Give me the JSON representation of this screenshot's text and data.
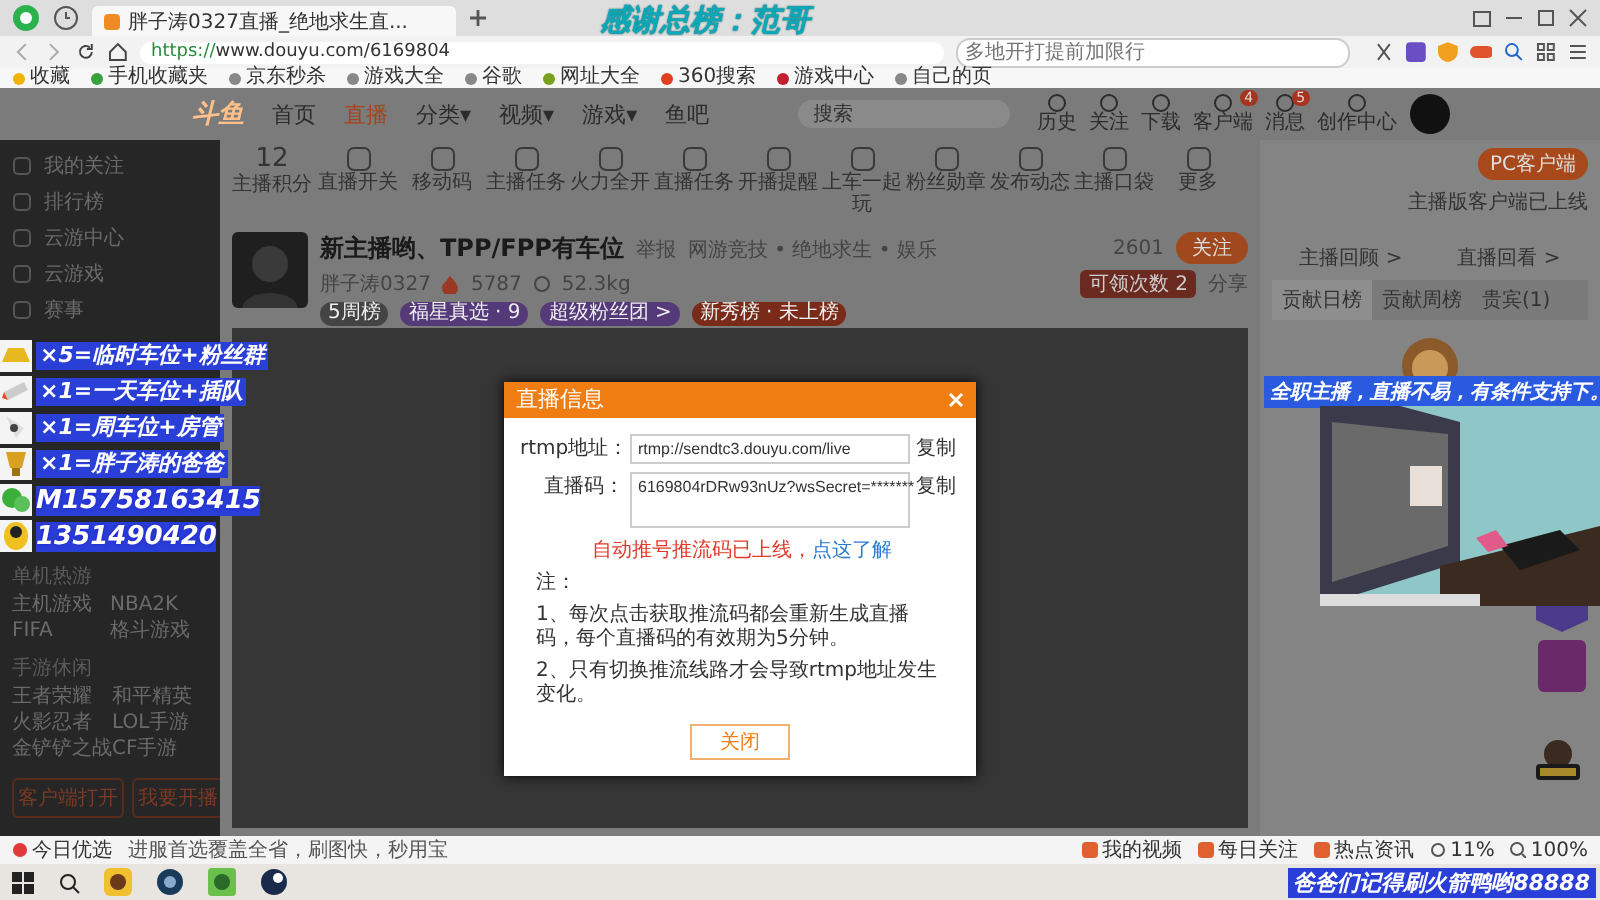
{
  "browser": {
    "tab_title": "胖子涛0327直播_绝地求生直...",
    "url": "https://www.douyu.com/6169804",
    "search": {
      "placeholder": "多地开打提前加限行"
    },
    "bookmarks": [
      "收藏",
      "手机收藏夹",
      "京东秒杀",
      "游戏大全",
      "谷歌",
      "网址大全",
      "360搜索",
      "游戏中心",
      "自己的页"
    ]
  },
  "site_nav": {
    "logo": "斗鱼",
    "items": [
      {
        "label": "首页",
        "selected": false
      },
      {
        "label": "直播",
        "selected": true
      },
      {
        "label": "分类▾",
        "selected": false
      },
      {
        "label": "视频▾",
        "selected": false
      },
      {
        "label": "游戏▾",
        "selected": false
      },
      {
        "label": "鱼吧",
        "selected": false
      }
    ],
    "search": {
      "placeholder": "搜索"
    },
    "actions": [
      {
        "label": "历史"
      },
      {
        "label": "关注"
      },
      {
        "label": "下载"
      },
      {
        "label": "客户端",
        "badge": "4"
      },
      {
        "label": "消息",
        "badge": "5"
      },
      {
        "label": "创作中心"
      }
    ]
  },
  "sidebar": {
    "items": [
      "我的关注",
      "排行榜",
      "云游中心",
      "云游戏",
      "赛事"
    ],
    "sections": [
      {
        "title": "单机热游",
        "games": [
          "主机游戏",
          "NBA2K",
          "FIFA",
          "格斗游戏"
        ]
      },
      {
        "title": "手游休闲",
        "games": [
          "王者荣耀",
          "和平精英",
          "火影忍者",
          "LOL手游",
          "金铲铲之战",
          "CF手游"
        ]
      }
    ],
    "buttons": [
      "客户端打开",
      "我要开播"
    ]
  },
  "toolbar": {
    "score": "12",
    "score_label": "主播积分",
    "tools": [
      "直播开关",
      "移动码",
      "主播任务",
      "火力全开",
      "直播任务",
      "开播提醒",
      "上车一起玩",
      "粉丝勋章",
      "发布动态",
      "主播口袋",
      "更多"
    ]
  },
  "streamer": {
    "title": "新主播哟、TPP/FPP有车位",
    "report": "举报",
    "category": "网游竞技 • 绝地求生 • 娱乐",
    "name": "胖子涛0327",
    "hot": "5787",
    "weight": "52.3kg",
    "badges": [
      "5周榜",
      "福星真选 · 9",
      "超级粉丝团 >",
      "新秀榜 · 未上榜"
    ],
    "followers": "2601",
    "follow": "关注",
    "share": "分享",
    "claim": "可领次数 2"
  },
  "dialog": {
    "title": "直播信息",
    "fields": [
      {
        "label": "rtmp地址：",
        "value": "rtmp://sendtc3.douyu.com/live",
        "action": "复制"
      },
      {
        "label": "直播码：",
        "value": "6169804rDRw93nUz?wsSecret=*******",
        "action": "复制"
      }
    ],
    "warning": "自动推号推流码已上线，",
    "warning_link": "点这了解",
    "notes": [
      "注：",
      "1、每次点击获取推流码都会重新生成直播码，每个直播码的有效期为5分钟。",
      "2、只有切换推流线路才会导致rtmp地址发生变化。"
    ],
    "button": "关闭"
  },
  "right_panel": {
    "client_button": "PC客户端",
    "client_note": "主播版客户端已上线",
    "links": [
      "主播回顾 >",
      "直播回看 >"
    ],
    "tabs": [
      {
        "label": "贡献日榜",
        "selected": true
      },
      {
        "label": "贡献周榜",
        "selected": false
      },
      {
        "label": "贵宾(1)",
        "selected": false
      }
    ]
  },
  "stream_overlays": {
    "top_banner": "感谢总榜：范哥",
    "gift_lines": [
      {
        "kind": "gold",
        "text": "×5=临时车位+粉丝群"
      },
      {
        "kind": "rocket",
        "text": "×1=一天车位+插队"
      },
      {
        "kind": "ship",
        "text": "×1=周车位+房管"
      },
      {
        "kind": "trophy",
        "text": "×1=胖子涛的爸爸"
      }
    ],
    "contacts": [
      {
        "kind": "wechat",
        "text": "M15758163415"
      },
      {
        "kind": "qq",
        "text": "1351490420"
      }
    ],
    "camera_caption": "全职主播，直播不易，有条件支持下。",
    "bottom_banner": "爸爸们记得刷火箭鸭哟88888"
  },
  "status_bar": {
    "left": "今日优选",
    "news": "进服首选覆盖全省，刷图快，秒用宝",
    "links": [
      "我的视频",
      "每日关注",
      "热点资讯"
    ],
    "cpu": "11%",
    "zoom": "100%"
  }
}
